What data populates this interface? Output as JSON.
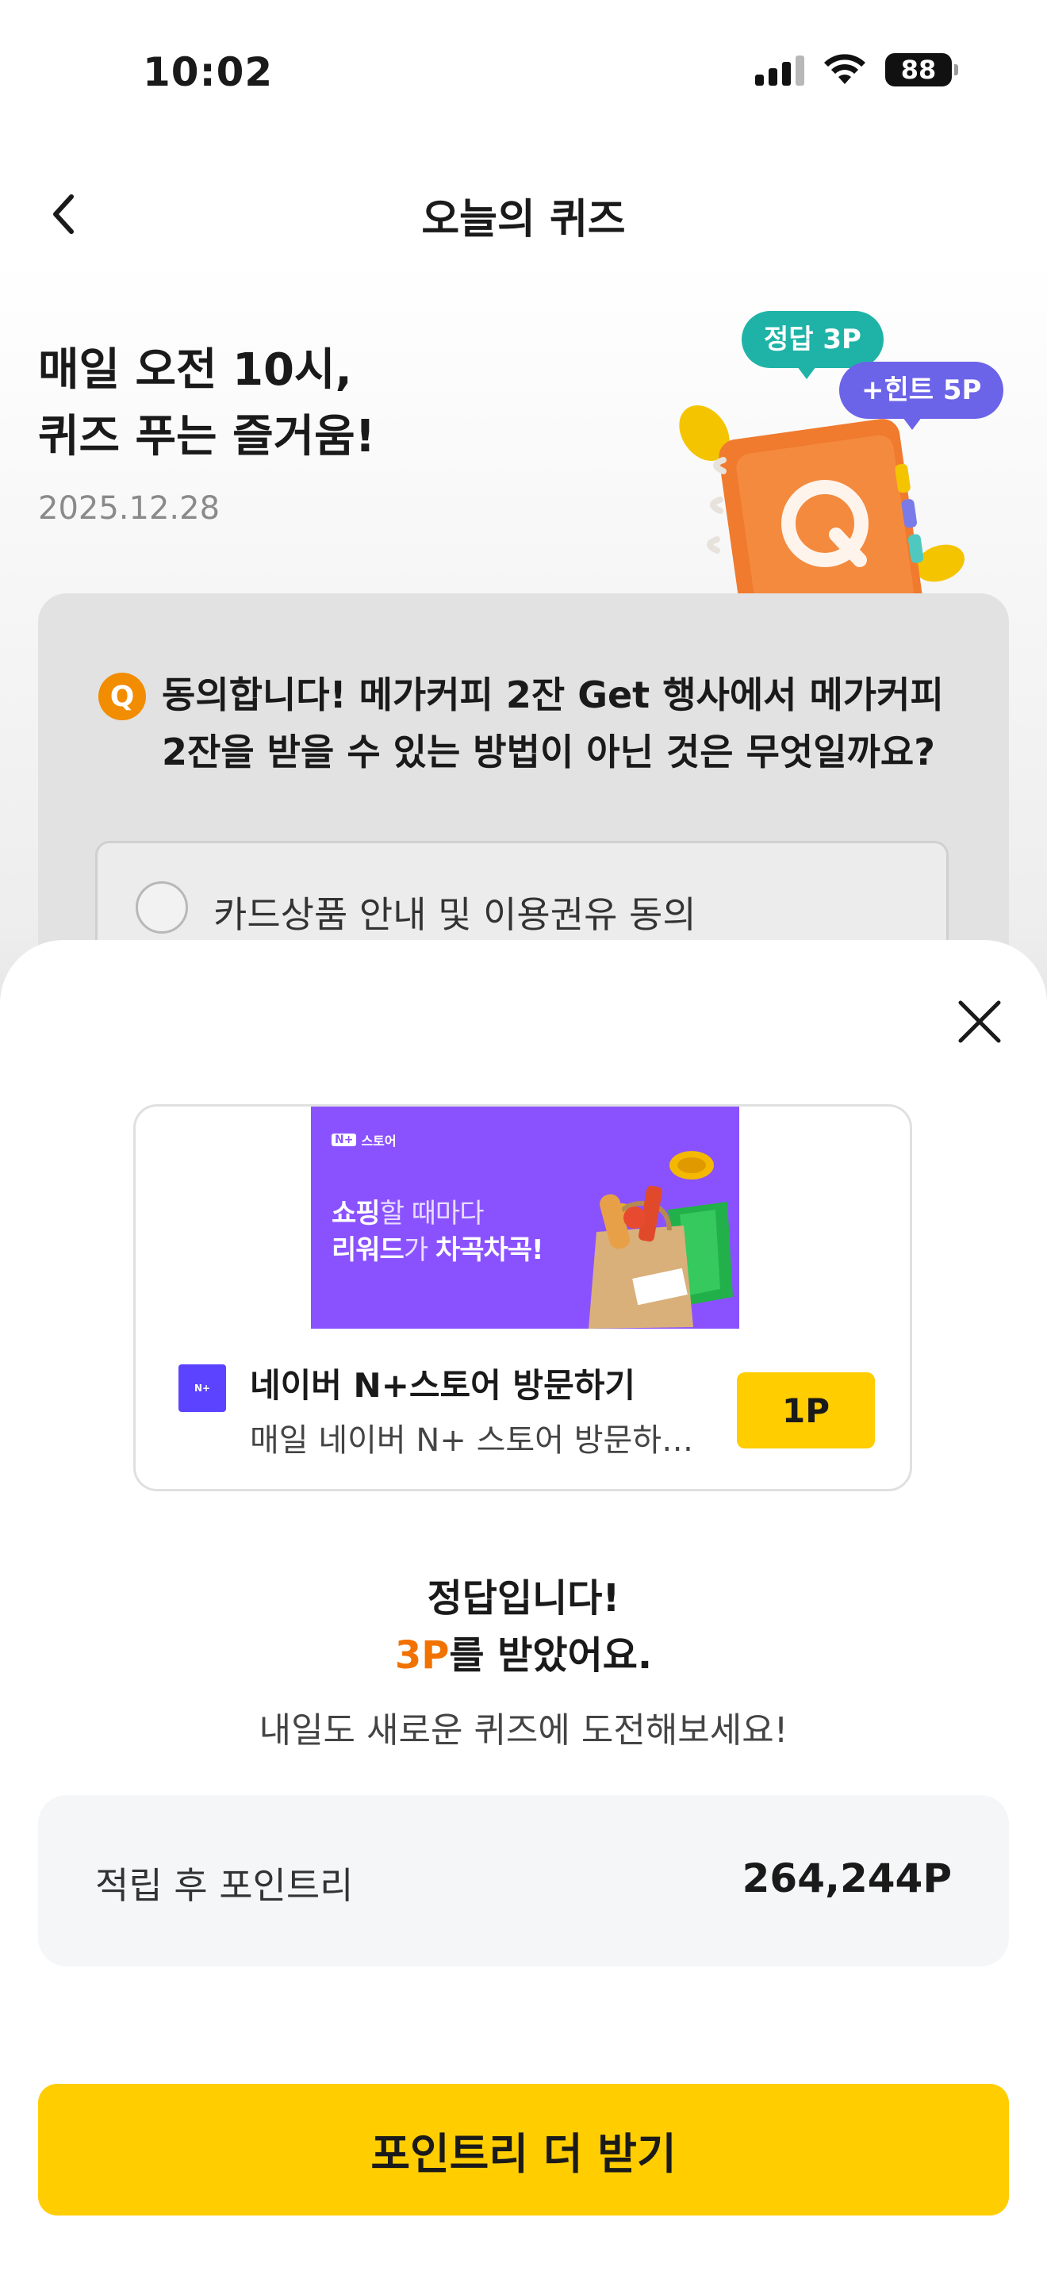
{
  "status_bar": {
    "time": "10:02",
    "battery": "88"
  },
  "nav": {
    "title": "오늘의 퀴즈"
  },
  "hero": {
    "title_line1": "매일 오전 10시,",
    "title_line2": "퀴즈 푸는 즐거움!",
    "date": "2025.12.28",
    "badge_correct": "정답 3P",
    "badge_hint": "+힌트 5P"
  },
  "question": {
    "badge": "Q",
    "text": "동의합니다! 메가커피 2잔 Get 행사에서 메가커피 2잔을 받을 수 있는 방법이 아닌 것은 무엇일까요?",
    "option1": "카드상품 안내 및 이용권유 동의"
  },
  "ad": {
    "banner_brand": "스토어",
    "banner_brand_box": "N+",
    "banner_line1_em": "쇼핑",
    "banner_line1_rest": "할 때마다",
    "banner_line2_em": "리워드",
    "banner_line2_mid": "가 ",
    "banner_line2_end": "차곡차곡!",
    "title": "네이버 N+스토어 방문하기",
    "description": "매일 네이버 N+ 스토어 방문하고 ...",
    "point_button": "1P"
  },
  "result": {
    "line1": "정답입니다!",
    "points": "3P",
    "line2_suffix": "를 받았어요.",
    "sub": "내일도 새로운 퀴즈에 도전해보세요!"
  },
  "balance": {
    "label": "적립 후 포인트리",
    "value": "264,244P"
  },
  "cta": {
    "label": "포인트리 더 받기"
  },
  "colors": {
    "accent_yellow": "#FFCD00",
    "points_orange": "#F27200",
    "badge_green": "#1FB3A8",
    "badge_purple": "#6B63E8",
    "ad_purple": "#8A52FF"
  }
}
